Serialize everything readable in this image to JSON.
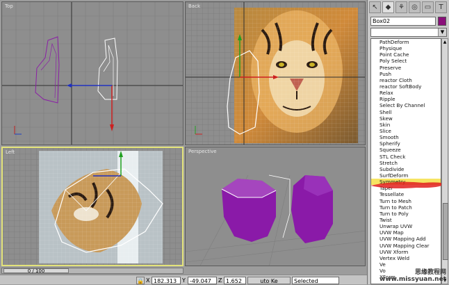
{
  "viewports": {
    "top": {
      "label": "Top"
    },
    "back": {
      "label": "Back"
    },
    "left": {
      "label": "Left"
    },
    "perspective": {
      "label": "Perspective"
    }
  },
  "panel": {
    "object_name": "Box02",
    "object_color": "#8a0f7a",
    "modifiers": [
      "PathDeform",
      "Physique",
      "Point Cache",
      "Poly Select",
      "Preserve",
      "Push",
      "reactor Cloth",
      "reactor SoftBody",
      "Relax",
      "Ripple",
      "Select By Channel",
      "Shell",
      "Skew",
      "Skin",
      "Slice",
      "Smooth",
      "Spherify",
      "Squeeze",
      "STL Check",
      "Stretch",
      "Subdivide",
      "SurfDeform",
      "Symmetry",
      "Taper",
      "Tessellate",
      "Turn to Mesh",
      "Turn to Patch",
      "Turn to Poly",
      "Twist",
      "Unwrap UVW",
      "UVW Map",
      "UVW Mapping Add",
      "UVW Mapping Clear",
      "UVW Xform",
      "Vertex Weld",
      "Ve",
      "Vo",
      "XForm"
    ],
    "selected_modifier": "Symmetry",
    "tab_icons": [
      "create-icon",
      "modify-icon",
      "hierarchy-icon",
      "motion-icon",
      "display-icon",
      "utilities-icon"
    ]
  },
  "timeline": {
    "frame": "0 / 100"
  },
  "status": {
    "x_label": "X",
    "x_value": "182.313",
    "y_label": "Y",
    "y_value": "-49.047",
    "z_label": "Z",
    "z_value": "1.652",
    "autokey_label": "uto Ke",
    "selection_value": "Selected"
  },
  "watermark": {
    "line1": "思缘教程网",
    "line2": "www.missyuan.net"
  },
  "colors": {
    "accent_selected": "#f6e463",
    "object_purple": "#8a1aa8",
    "highlight_red": "#e02020"
  }
}
